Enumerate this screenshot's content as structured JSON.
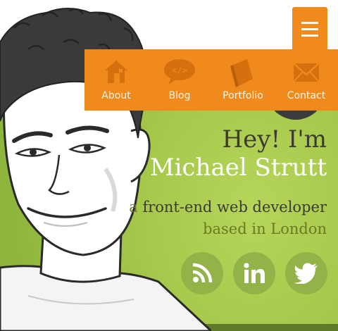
{
  "colors": {
    "accent": "#f08a1c",
    "background": "#a3c548",
    "icon_tint": "#d4700e",
    "social_circle": "#93b248"
  },
  "menu": {
    "icon": "hamburger-icon"
  },
  "nav": {
    "items": [
      {
        "label": "About",
        "icon": "house-icon"
      },
      {
        "label": "Blog",
        "icon": "code-speech-bubble-icon"
      },
      {
        "label": "Portfolio",
        "icon": "book-icon"
      },
      {
        "label": "Contact",
        "icon": "envelope-icon"
      }
    ]
  },
  "hero": {
    "greeting": "Hey! I'm",
    "name": "Michael Strutt",
    "article": "a",
    "role": "front-end web developer",
    "location": "based in London"
  },
  "social": {
    "items": [
      {
        "icon": "rss-icon"
      },
      {
        "icon": "linkedin-icon"
      },
      {
        "icon": "twitter-icon"
      }
    ]
  }
}
